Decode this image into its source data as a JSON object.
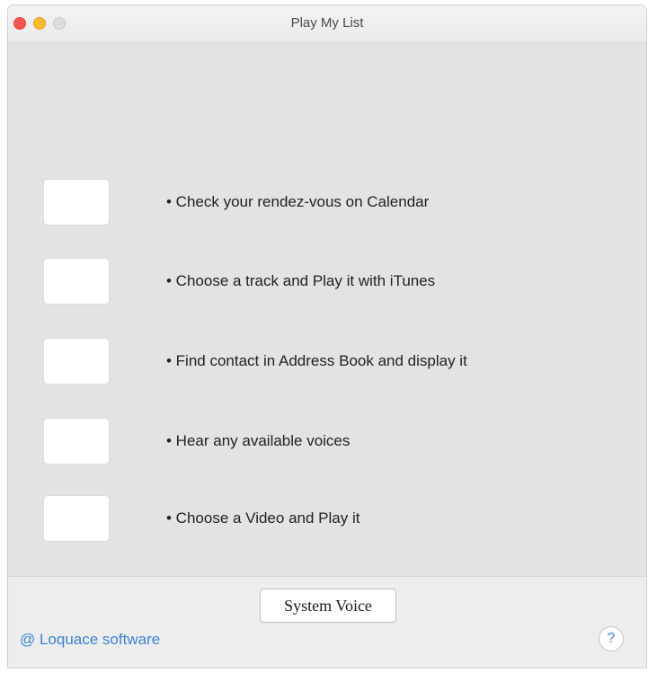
{
  "window": {
    "title": "Play My List"
  },
  "tasks": [
    {
      "label": "• Check your rendez-vous on Calendar"
    },
    {
      "label": "• Choose a track and Play it with iTunes"
    },
    {
      "label": "• Find contact in Address Book and display it"
    },
    {
      "label": "• Hear any available voices"
    },
    {
      "label": "• Choose a Video and Play it"
    }
  ],
  "footer": {
    "system_voice_label": "System Voice",
    "company_link": "@ Loquace software",
    "help_label": "?"
  },
  "colors": {
    "close": "#f5564e",
    "minimize": "#f9bb2d",
    "zoom": "#dcdcdc",
    "link": "#3b82d9"
  }
}
